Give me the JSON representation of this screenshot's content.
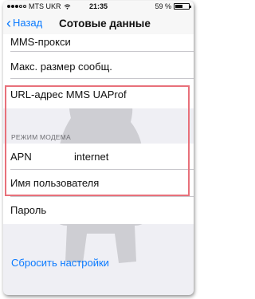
{
  "status_bar": {
    "carrier": "MTS UKR",
    "time": "21:35",
    "battery": "59 %",
    "battery_level": 0.59
  },
  "nav": {
    "back_label": "Назад",
    "title": "Сотовые данные"
  },
  "rows": {
    "mms_proxy": "MMS-прокси",
    "max_message_size": "Макс. размер сообщ.",
    "mms_uaprof_url": "URL-адрес MMS UAProf"
  },
  "modem_section": {
    "header": "РЕЖИМ МОДЕМА",
    "apn_label": "APN",
    "apn_value": "internet",
    "username_label": "Имя пользователя",
    "password_label": "Пароль"
  },
  "reset_label": "Сбросить настройки",
  "colors": {
    "accent": "#0a7aff",
    "highlight": "#e8707a",
    "background": "#efeff4"
  }
}
